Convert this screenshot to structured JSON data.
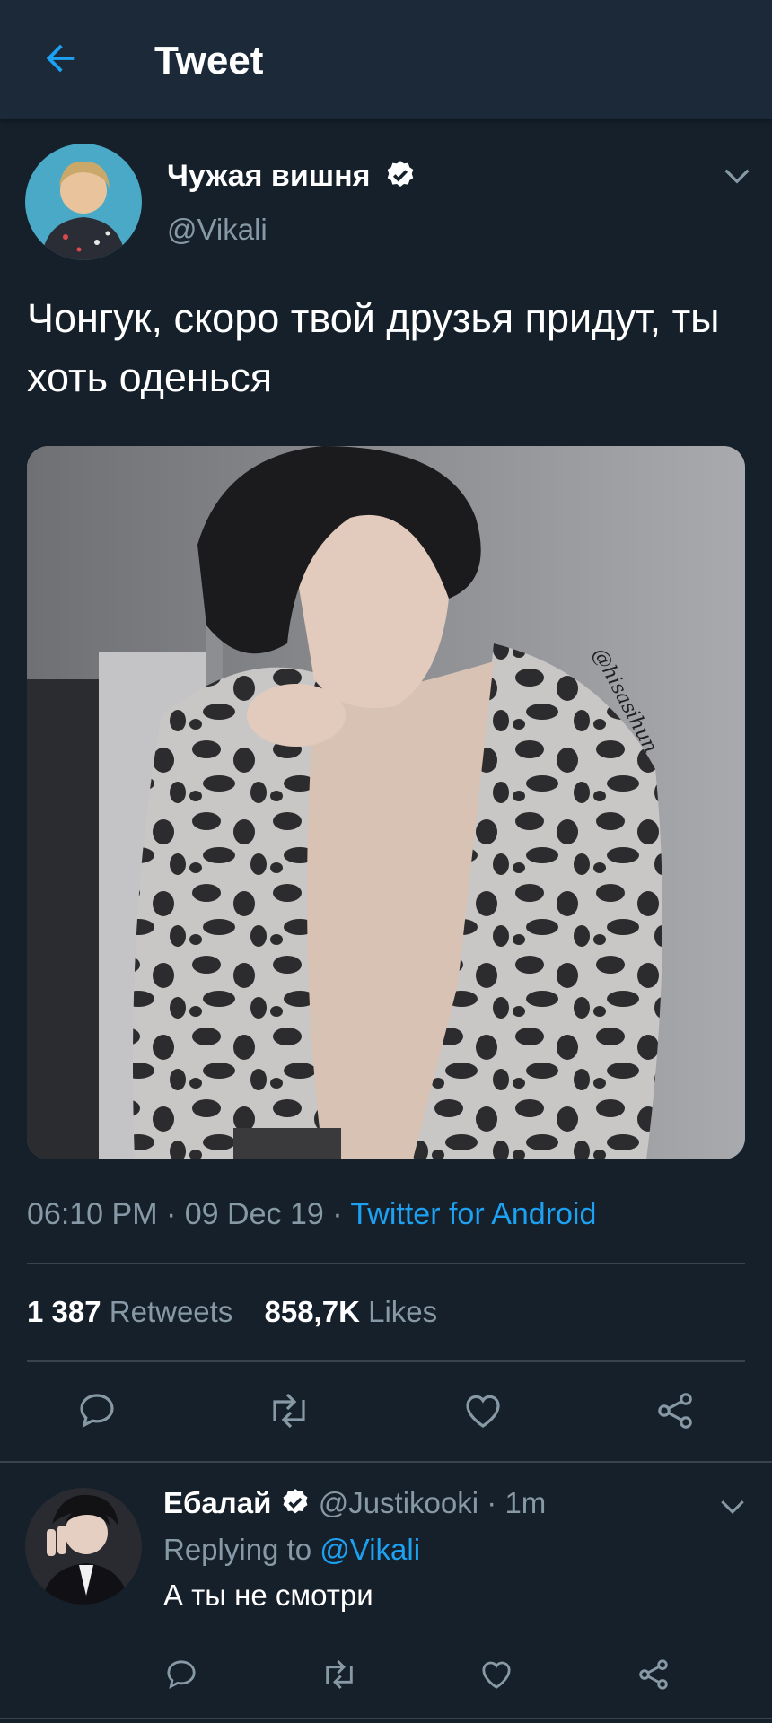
{
  "header": {
    "title": "Tweet",
    "back_icon": "arrow-left-icon"
  },
  "tweet": {
    "author_name": "Чужая вишня",
    "author_handle": "@Vikali",
    "verified": true,
    "text": "Чонгук, скоро твой друзья придут, ты хоть оденься",
    "image_watermark": "@hisasihun",
    "time": "06:10 PM",
    "date": "09 Dec 19",
    "source": "Twitter for Android",
    "separator": "·",
    "retweets_count": "1 387",
    "retweets_label": "Retweets",
    "likes_count": "858,7K",
    "likes_label": "Likes",
    "actions": [
      "reply-icon",
      "retweet-icon",
      "heart-icon",
      "share-icon"
    ]
  },
  "reply": {
    "author_name": "Ебалай",
    "author_handle": "@Justikooki",
    "time_ago": "1m",
    "separator": "·",
    "replying_label": "Replying to",
    "replying_handle": "@Vikali",
    "text": "А ты не смотри",
    "actions": [
      "reply-icon",
      "retweet-icon",
      "heart-icon",
      "share-icon"
    ]
  },
  "colors": {
    "background": "#15202b",
    "header": "#1c2938",
    "accent": "#1da1f2",
    "muted": "#8899a6",
    "divider": "#38444d"
  }
}
